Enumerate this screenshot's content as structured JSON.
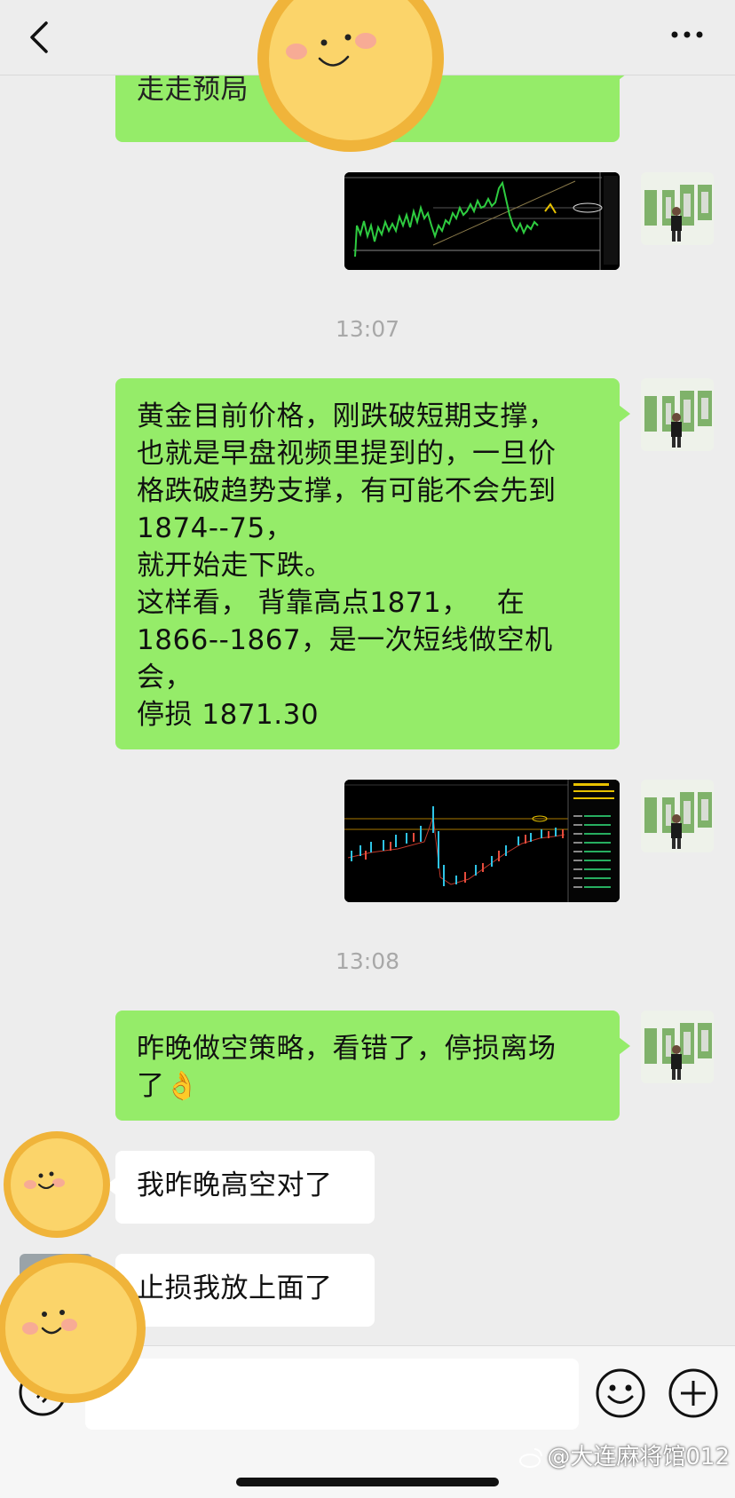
{
  "header": {
    "back_label": "",
    "more_label": ""
  },
  "messages": {
    "m0_partial": "走走预局",
    "ts1": "13:07",
    "m1_text": "黄金目前价格，刚跌破短期支撑，\n也就是早盘视频里提到的，一旦价\n格跌破趋势支撑，有可能不会先到\n1874--75，\n就开始走下跌。\n这样看， 背靠高点1871，   在\n1866--1867，是一次短线做空机\n会，\n停损 1871.30",
    "ts2": "13:08",
    "m2_text": "昨晚做空策略，看错了，停损离场\n了👌",
    "m3_text": "我昨晚高空对了",
    "m4_text": "止损我放上面了"
  },
  "input": {
    "placeholder": ""
  },
  "watermark": {
    "text": "@大连麻将馆012"
  },
  "colors": {
    "self_bubble": "#95ec69",
    "other_bubble": "#ffffff",
    "background": "#ededed"
  },
  "icons": [
    "chevron-left-icon",
    "more-dots-icon",
    "voice-icon",
    "emoji-icon",
    "plus-icon",
    "sun-sticker"
  ]
}
